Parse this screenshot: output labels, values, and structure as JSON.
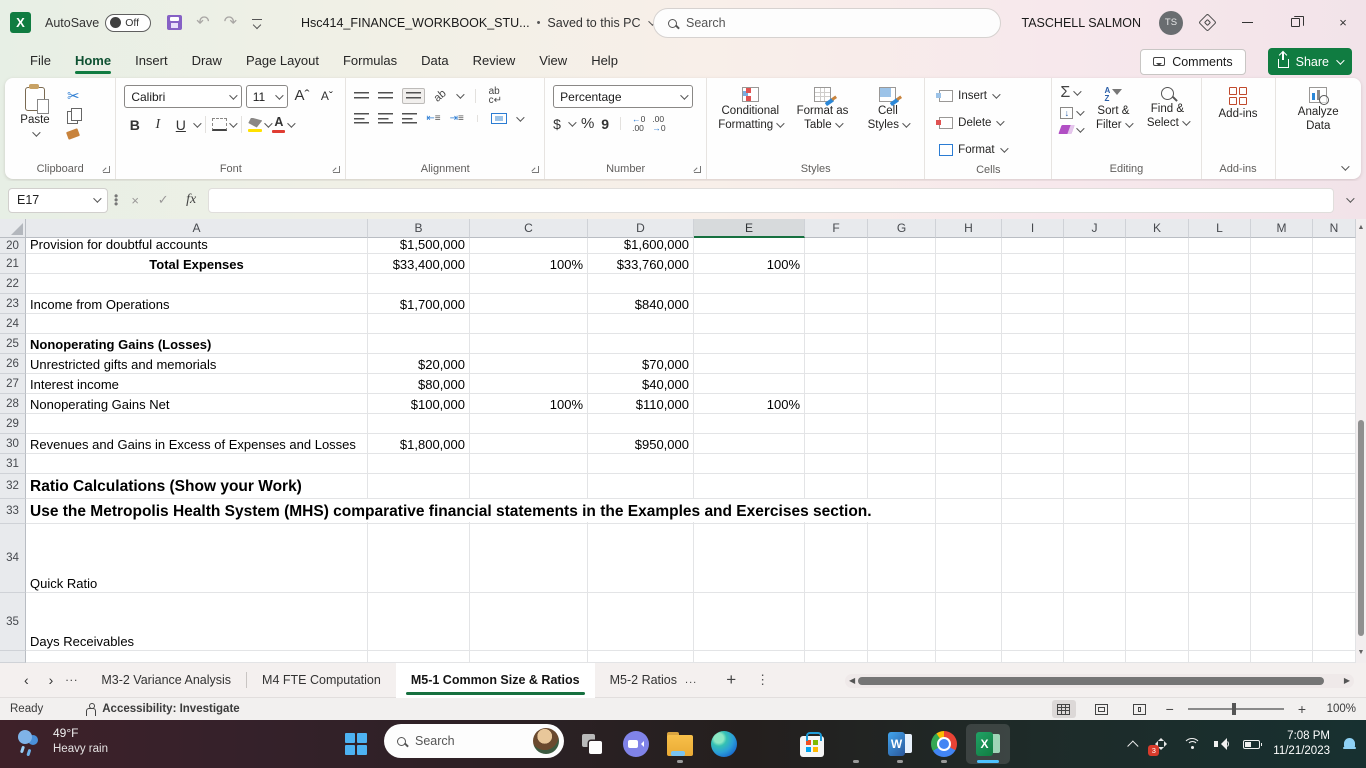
{
  "titlebar": {
    "autosave_label": "AutoSave",
    "autosave_state": "Off",
    "doc_title": "Hsc414_FINANCE_WORKBOOK_STU...",
    "saved_separator": "•",
    "saved_status": "Saved to this PC",
    "search_placeholder": "Search",
    "user_name": "TASCHELL SALMON",
    "user_initials": "TS"
  },
  "ribbon_tabs": {
    "items": [
      {
        "label": "File",
        "active": false
      },
      {
        "label": "Home",
        "active": true
      },
      {
        "label": "Insert",
        "active": false
      },
      {
        "label": "Draw",
        "active": false
      },
      {
        "label": "Page Layout",
        "active": false
      },
      {
        "label": "Formulas",
        "active": false
      },
      {
        "label": "Data",
        "active": false
      },
      {
        "label": "Review",
        "active": false
      },
      {
        "label": "View",
        "active": false
      },
      {
        "label": "Help",
        "active": false
      }
    ],
    "comments_label": "Comments",
    "share_label": "Share"
  },
  "ribbon": {
    "paste_label": "Paste",
    "font_name": "Calibri",
    "font_size": "11",
    "bold_label": "B",
    "italic_label": "I",
    "underline_label": "U",
    "number_format": "Percentage",
    "currency_symbol": "$",
    "percent_symbol": "%",
    "comma_symbol": "9",
    "conditional_formatting_label": "Conditional Formatting",
    "format_as_table_label": "Format as Table",
    "cell_styles_label": "Cell Styles",
    "insert_label": "Insert",
    "delete_label": "Delete",
    "format_label": "Format",
    "sort_filter_label": "Sort & Filter",
    "find_select_label": "Find & Select",
    "addins_button_label": "Add-ins",
    "analyze_data_label": "Analyze Data",
    "group_labels": {
      "clipboard": "Clipboard",
      "font": "Font",
      "alignment": "Alignment",
      "number": "Number",
      "styles": "Styles",
      "cells": "Cells",
      "editing": "Editing",
      "addins": "Add-ins"
    }
  },
  "formula_bar": {
    "name_box": "E17",
    "formula": ""
  },
  "grid": {
    "columns": [
      "A",
      "B",
      "C",
      "D",
      "E",
      "F",
      "G",
      "H",
      "I",
      "J",
      "K",
      "L",
      "M",
      "N"
    ],
    "selected_column": "E",
    "rows": [
      {
        "num": "20",
        "cells": {
          "A": "Provision for doubtful accounts",
          "B": "$1,500,000",
          "D": "$1,600,000"
        },
        "style": ""
      },
      {
        "num": "21",
        "cells": {
          "A": "Total Expenses",
          "B": "$33,400,000",
          "C": "100%",
          "D": "$33,760,000",
          "E": "100%"
        },
        "style": "bold center"
      },
      {
        "num": "22",
        "cells": {},
        "style": ""
      },
      {
        "num": "23",
        "cells": {
          "A": "Income from Operations",
          "B": "$1,700,000",
          "D": "$840,000"
        },
        "style": ""
      },
      {
        "num": "24",
        "cells": {},
        "style": ""
      },
      {
        "num": "25",
        "cells": {
          "A": "Nonoperating Gains (Losses)"
        },
        "style": "bold"
      },
      {
        "num": "26",
        "cells": {
          "A": "Unrestricted gifts and memorials",
          "B": "$20,000",
          "D": "$70,000"
        },
        "style": ""
      },
      {
        "num": "27",
        "cells": {
          "A": "Interest income",
          "B": "$80,000",
          "D": "$40,000"
        },
        "style": ""
      },
      {
        "num": "28",
        "cells": {
          "A": "Nonoperating Gains Net",
          "B": "$100,000",
          "C": "100%",
          "D": "$110,000",
          "E": "100%"
        },
        "style": ""
      },
      {
        "num": "29",
        "cells": {},
        "style": ""
      },
      {
        "num": "30",
        "cells": {
          "A": "Revenues and Gains in Excess of Expenses and Losses",
          "B": "$1,800,000",
          "D": "$950,000"
        },
        "style": ""
      },
      {
        "num": "31",
        "cells": {},
        "style": ""
      },
      {
        "num": "32",
        "cells": {
          "A": "Ratio Calculations (Show your Work)"
        },
        "style": "bold lg overflow"
      },
      {
        "num": "33",
        "cells": {
          "A": "Use the Metropolis Health System (MHS) comparative financial statements in the Examples and Exercises section."
        },
        "style": "bold lg overflow"
      },
      {
        "num": "34",
        "cells": {
          "A": "Quick Ratio"
        },
        "style": ""
      },
      {
        "num": "35",
        "cells": {
          "A": "Days Receivables"
        },
        "style": ""
      },
      {
        "num": "",
        "cells": {},
        "style": ""
      }
    ]
  },
  "sheet_tabs": {
    "tabs": [
      {
        "label": "M3-2 Variance Analysis",
        "active": false,
        "more": false
      },
      {
        "label": "M4 FTE Computation",
        "active": false,
        "more": false
      },
      {
        "label": "M5-1 Common Size & Ratios",
        "active": true,
        "more": false
      },
      {
        "label": "M5-2 Ratios",
        "active": false,
        "more": true
      }
    ]
  },
  "status_bar": {
    "mode": "Ready",
    "accessibility": "Accessibility: Investigate",
    "zoom_level": "100%"
  },
  "taskbar": {
    "weather_temp": "49°F",
    "weather_desc": "Heavy rain",
    "search_placeholder": "Search",
    "tray_badge_count": "3",
    "clock_time": "7:08 PM",
    "clock_date": "11/21/2023"
  },
  "colors": {
    "excel_green": "#107C41",
    "selection_green": "#16703f",
    "taskbar_accent_blue": "#4cc2ff",
    "fill_yellow": "#ffe100",
    "font_color_red": "#e03c32"
  }
}
